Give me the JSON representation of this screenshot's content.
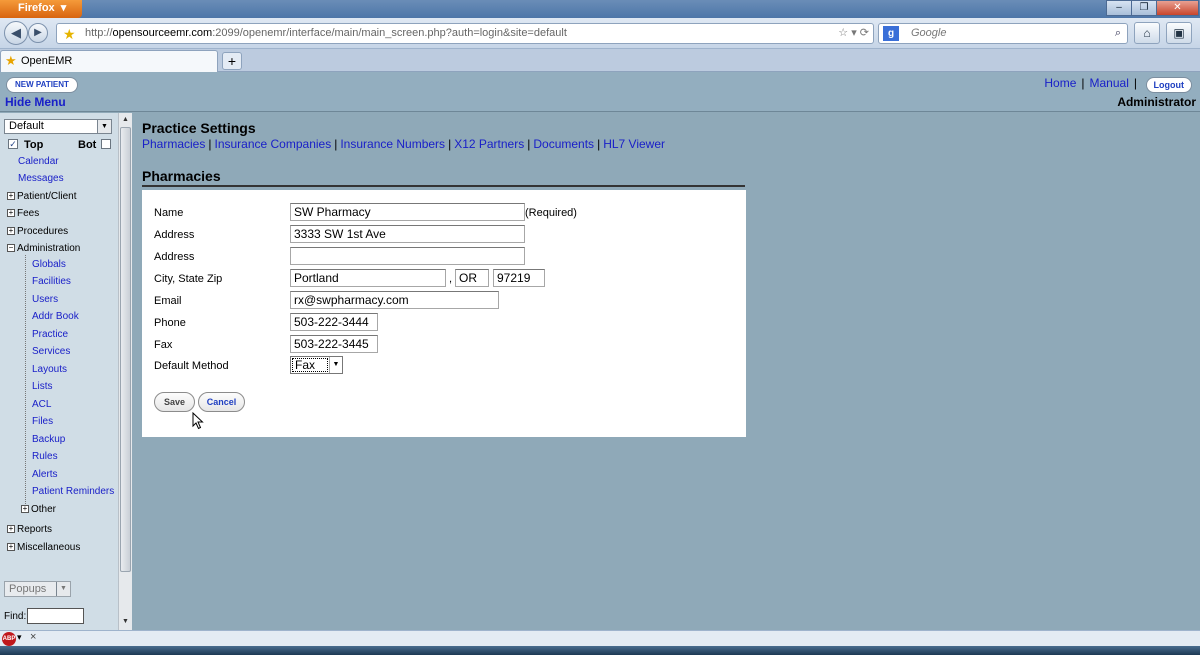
{
  "browser": {
    "menu_button": "Firefox",
    "url_protocol": "http://",
    "url_host": "opensourceemr.com",
    "url_path": ":2099/openemr/interface/main/main_screen.php?auth=login&site=default",
    "search_placeholder": "Google",
    "tab_title": "OpenEMR",
    "new_tab": "+"
  },
  "header": {
    "new_patient": "NEW PATIENT",
    "hide_menu": "Hide Menu",
    "home": "Home",
    "separator": "|",
    "manual": "Manual",
    "logout": "Logout",
    "user": "Administrator"
  },
  "nav": {
    "layout_select": "Default",
    "top_label": "Top",
    "bot_label": "Bot",
    "calendar": "Calendar",
    "messages": "Messages",
    "patient_client": "Patient/Client",
    "fees": "Fees",
    "procedures": "Procedures",
    "administration": "Administration",
    "admin_items": [
      "Globals",
      "Facilities",
      "Users",
      "Addr Book",
      "Practice",
      "Services",
      "Layouts",
      "Lists",
      "ACL",
      "Files",
      "Backup",
      "Rules",
      "Alerts",
      "Patient Reminders"
    ],
    "other": "Other",
    "reports": "Reports",
    "miscellaneous": "Miscellaneous",
    "popups": "Popups",
    "find_label": "Find:"
  },
  "main": {
    "title": "Practice Settings",
    "links": [
      "Pharmacies",
      "Insurance Companies",
      "Insurance Numbers",
      "X12 Partners",
      "Documents",
      "HL7 Viewer"
    ],
    "link_sep": "|",
    "section_title": "Pharmacies"
  },
  "form": {
    "name_label": "Name",
    "name_value": "SW Pharmacy",
    "required_note": "(Required)",
    "address_label": "Address",
    "address1_value": "3333 SW 1st Ave",
    "address2_label": "Address",
    "address2_value": "",
    "city_label": "City, State Zip",
    "city_value": "Portland",
    "comma": ",",
    "state_value": "OR",
    "zip_value": "97219",
    "email_label": "Email",
    "email_value": "rx@swpharmacy.com",
    "phone_label": "Phone",
    "phone_value": "503-222-3444",
    "fax_label": "Fax",
    "fax_value": "503-222-3445",
    "method_label": "Default Method",
    "method_value": "Fax",
    "save": "Save",
    "cancel": "Cancel"
  },
  "status": {
    "addon": "ABP",
    "close": "×"
  },
  "colors": {
    "link": "#1a20c8",
    "page_bg": "#8fa9b8",
    "nav_bg": "#d0dde6"
  }
}
